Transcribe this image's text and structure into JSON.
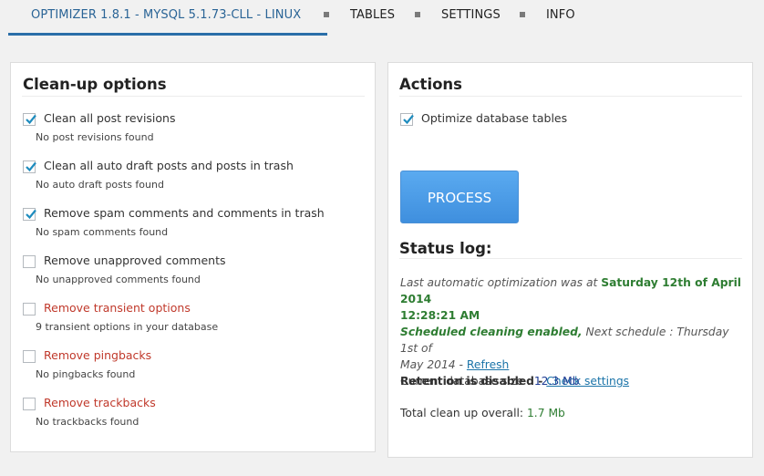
{
  "tabs": [
    {
      "label": "OPTIMIZER 1.8.1 - MYSQL 5.1.73-CLL - LINUX"
    },
    {
      "label": "TABLES"
    },
    {
      "label": "SETTINGS"
    },
    {
      "label": "INFO"
    }
  ],
  "cleanup": {
    "title": "Clean-up options",
    "options": [
      {
        "label": "Clean all post revisions",
        "sub": "No post revisions found",
        "checked": true
      },
      {
        "label": "Clean all auto draft posts and posts in trash",
        "sub": "No auto draft posts found",
        "checked": true
      },
      {
        "label": "Remove spam comments and comments in trash",
        "sub": "No spam comments found",
        "checked": true
      },
      {
        "label": "Remove unapproved comments",
        "sub": "No unapproved comments found",
        "checked": false
      },
      {
        "label": "Remove transient options",
        "sub": "9 transient options in your database",
        "checked": false
      },
      {
        "label": "Remove pingbacks",
        "sub": "No pingbacks found",
        "checked": false
      },
      {
        "label": "Remove trackbacks",
        "sub": "No trackbacks found",
        "checked": false
      }
    ]
  },
  "actions": {
    "title": "Actions",
    "optimize_label": "Optimize database tables",
    "optimize_checked": true,
    "process_label": "PROCESS",
    "status_title": "Status log:",
    "last_run_prefix": "Last automatic optimization was at",
    "last_run_value_1": "Saturday 12th of April 2014",
    "last_run_value_2": "12:28:21 AM",
    "scheduled_enabled": "Scheduled cleaning enabled,",
    "next_schedule_1": "Next schedule : Thursday 1st of",
    "next_schedule_2": "May 2014 -",
    "refresh_link": "Refresh",
    "retention_text": "Retention is disabled -",
    "check_settings_link": "Check settings",
    "db_size_label": "Current database size :",
    "db_size_value": "12.3 Mb",
    "total_label": "Total clean up overall:",
    "total_value": "1.7 Mb"
  },
  "colors": {
    "accent": "#2a6ea8",
    "warning_red": "#c0392b",
    "status_green": "#2e7d32",
    "link_blue": "#1a73a8",
    "button_blue": "#4a9ae8"
  }
}
